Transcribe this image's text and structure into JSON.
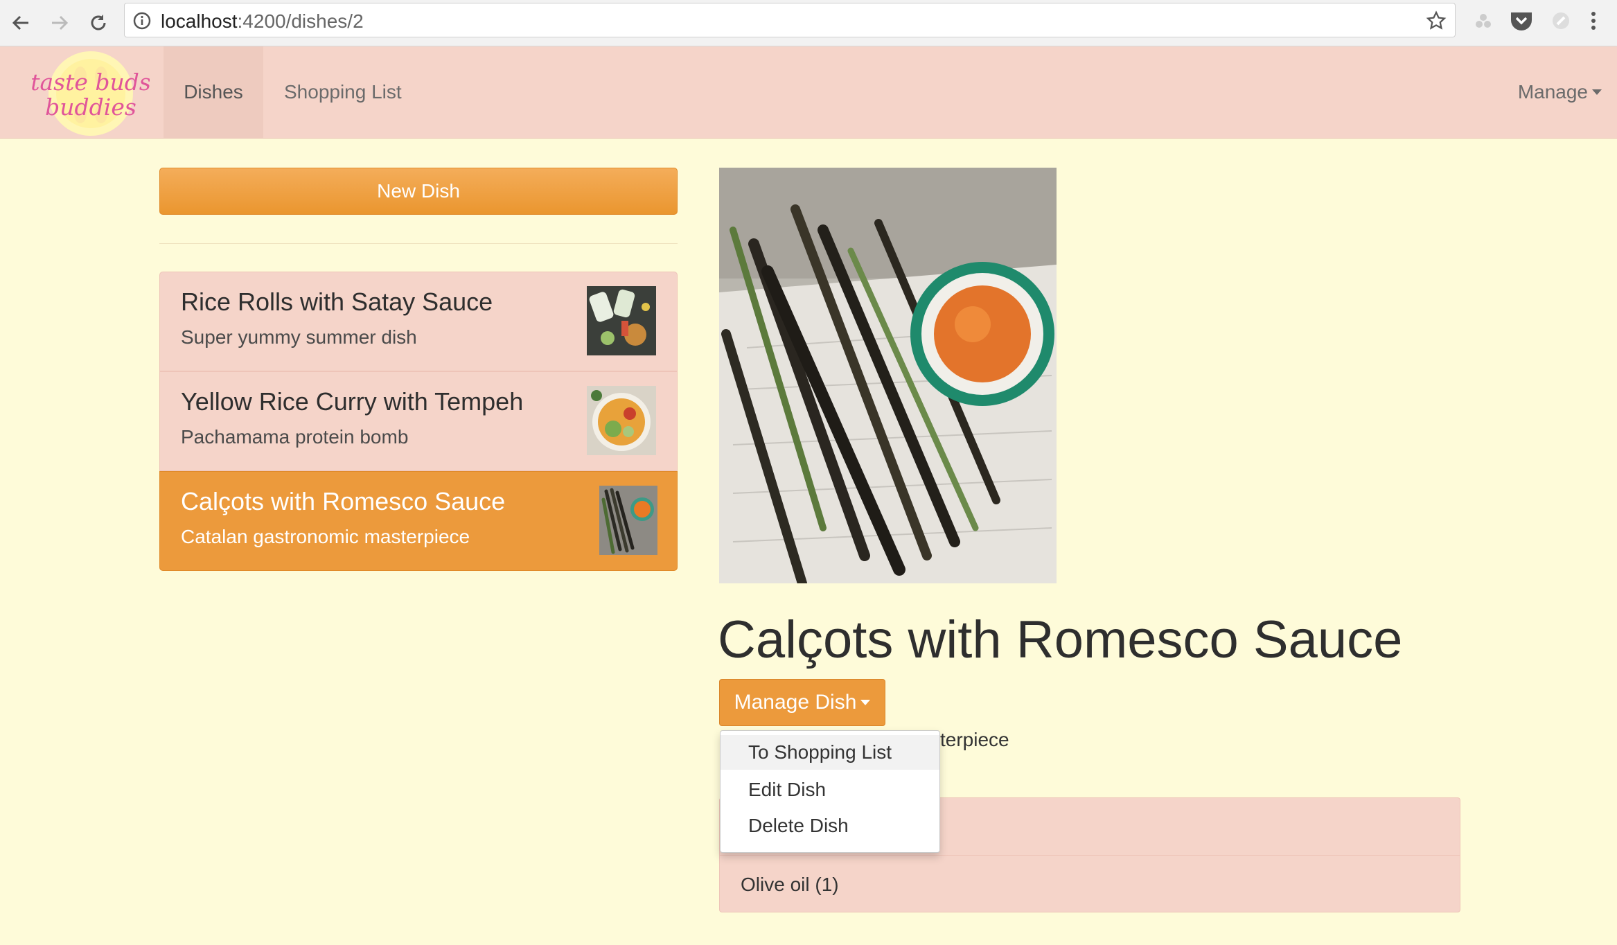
{
  "browser": {
    "url_host": "localhost",
    "url_path": ":4200/dishes/2"
  },
  "navbar": {
    "logo_text": "taste buds buddies",
    "tabs": [
      {
        "label": "Dishes",
        "active": true
      },
      {
        "label": "Shopping List",
        "active": false
      }
    ],
    "manage_label": "Manage"
  },
  "sidebar": {
    "new_dish_label": "New Dish",
    "dishes": [
      {
        "name": "Rice Rolls with Satay Sauce",
        "description": "Super yummy summer dish",
        "active": false
      },
      {
        "name": "Yellow Rice Curry with Tempeh",
        "description": "Pachamama protein bomb",
        "active": false
      },
      {
        "name": "Calçots with Romesco Sauce",
        "description": "Catalan gastronomic masterpiece",
        "active": true
      }
    ]
  },
  "detail": {
    "title": "Calçots with Romesco Sauce",
    "manage_button_label": "Manage Dish",
    "description_visible": "terpiece",
    "ingredients": [
      "Olive oil (1)"
    ]
  },
  "dropdown": {
    "items": [
      "To Shopping List",
      "Edit Dish",
      "Delete Dish"
    ]
  },
  "colors": {
    "page_bg": "#fefbd9",
    "navbar_bg": "#f5d4c9",
    "accent": "#ec9a3c"
  }
}
